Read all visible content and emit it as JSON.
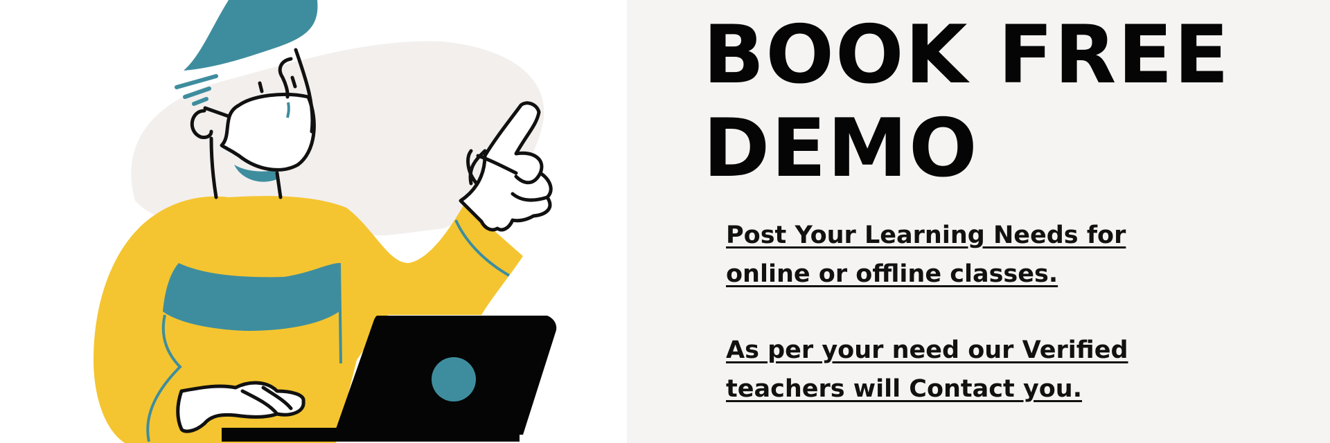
{
  "headline": {
    "line1": "BOOK FREE",
    "line2": "DEMO"
  },
  "info": [
    {
      "line1": "Post Your Learning Needs for",
      "line2": "online or offline classes."
    },
    {
      "line1": "As per your need our Verified",
      "line2": "teachers will Contact you."
    }
  ],
  "colors": {
    "accent_yellow": "#f4c530",
    "accent_teal": "#3e8d9e",
    "blob": "#f3efed",
    "panel_background": "#f5f4f2",
    "text": "#050505"
  },
  "illustration": {
    "subject": "person-at-laptop-raising-finger",
    "icons": [
      "speech-lines-icon",
      "laptop-icon"
    ]
  }
}
